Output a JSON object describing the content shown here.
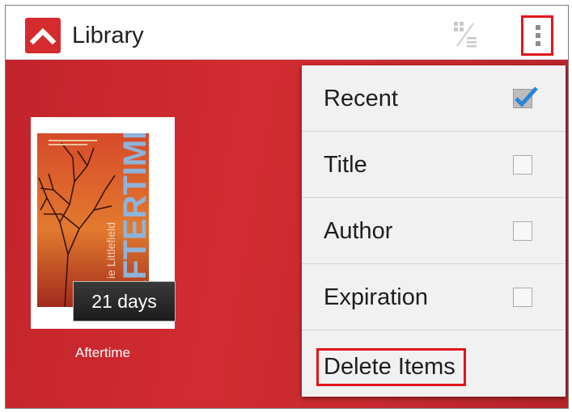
{
  "appbar": {
    "title": "Library",
    "logo_icon": "up-arrow-logo-icon",
    "view_toggle_icon": "grid-list-toggle-icon",
    "overflow_icon": "overflow-menu-icon",
    "accent_color": "#d42b2f",
    "highlight_color": "#e0161b"
  },
  "library": {
    "background_color": "#c8282e",
    "books": [
      {
        "title": "Aftertime",
        "cover_title": "AFTERTIME",
        "cover_author": "ie Littlefield",
        "loan_badge": "21 days"
      }
    ]
  },
  "sort_menu": {
    "items": [
      {
        "label": "Recent",
        "checked": true
      },
      {
        "label": "Title",
        "checked": false
      },
      {
        "label": "Author",
        "checked": false
      },
      {
        "label": "Expiration",
        "checked": false
      }
    ],
    "delete_label": "Delete Items"
  }
}
